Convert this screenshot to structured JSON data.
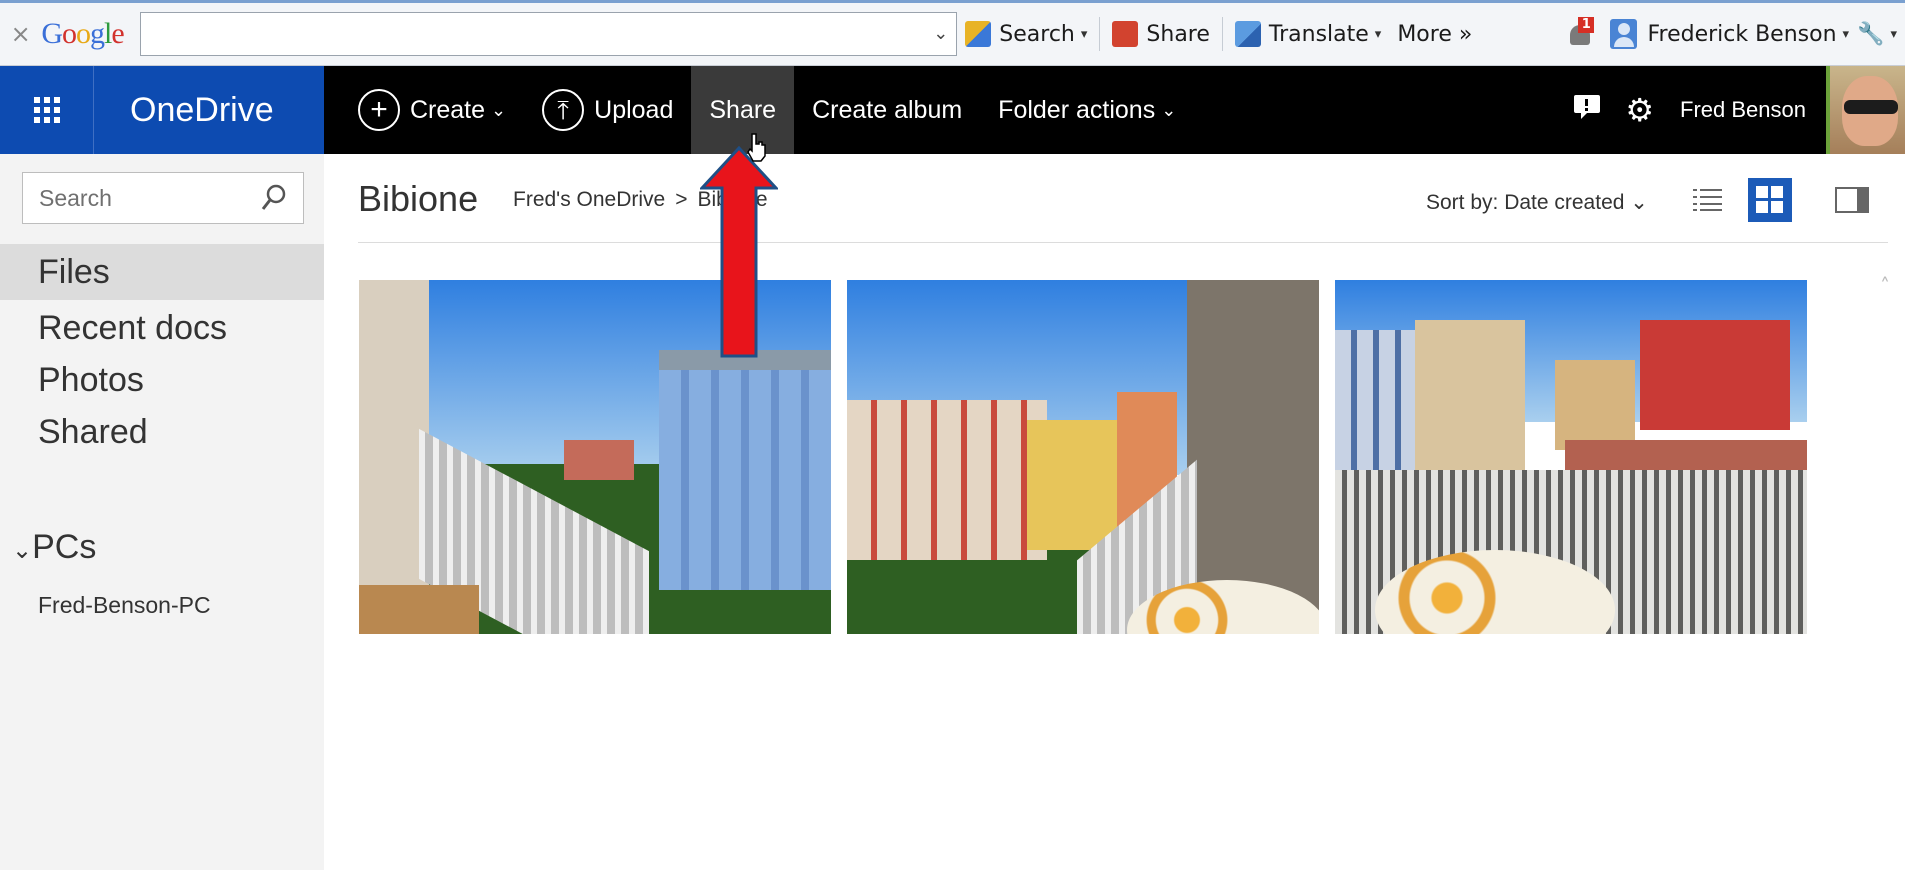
{
  "google_toolbar": {
    "close": "×",
    "logo_letters": [
      "G",
      "o",
      "o",
      "g",
      "l",
      "e"
    ],
    "search_value": "",
    "search_button": "Search",
    "share_button": "Share",
    "translate_button": "Translate",
    "more_button": "More »",
    "notification_count": "1",
    "user_name": "Frederick Benson"
  },
  "onedrive_bar": {
    "brand": "OneDrive",
    "commands": {
      "create": "Create",
      "upload": "Upload",
      "share": "Share",
      "create_album": "Create album",
      "folder_actions": "Folder actions"
    },
    "user_name": "Fred Benson"
  },
  "sidebar": {
    "search_placeholder": "Search",
    "items": [
      {
        "label": "Files",
        "selected": true
      },
      {
        "label": "Recent docs"
      },
      {
        "label": "Photos"
      },
      {
        "label": "Shared"
      }
    ],
    "pcs_label": "PCs",
    "pc_name": "Fred-Benson-PC"
  },
  "main": {
    "title": "Bibione",
    "breadcrumb_root": "Fred's OneDrive",
    "breadcrumb_sep": ">",
    "breadcrumb_current": "Bibione",
    "sort_label": "Sort by: Date created",
    "thumbnails": [
      "balcony-view-1",
      "balcony-view-2",
      "balcony-view-3"
    ]
  },
  "colors": {
    "brand_blue": "#0d4bb1",
    "command_bar": "#000000",
    "annotation_red": "#e8141b",
    "selected_view": "#1c5bb8"
  }
}
